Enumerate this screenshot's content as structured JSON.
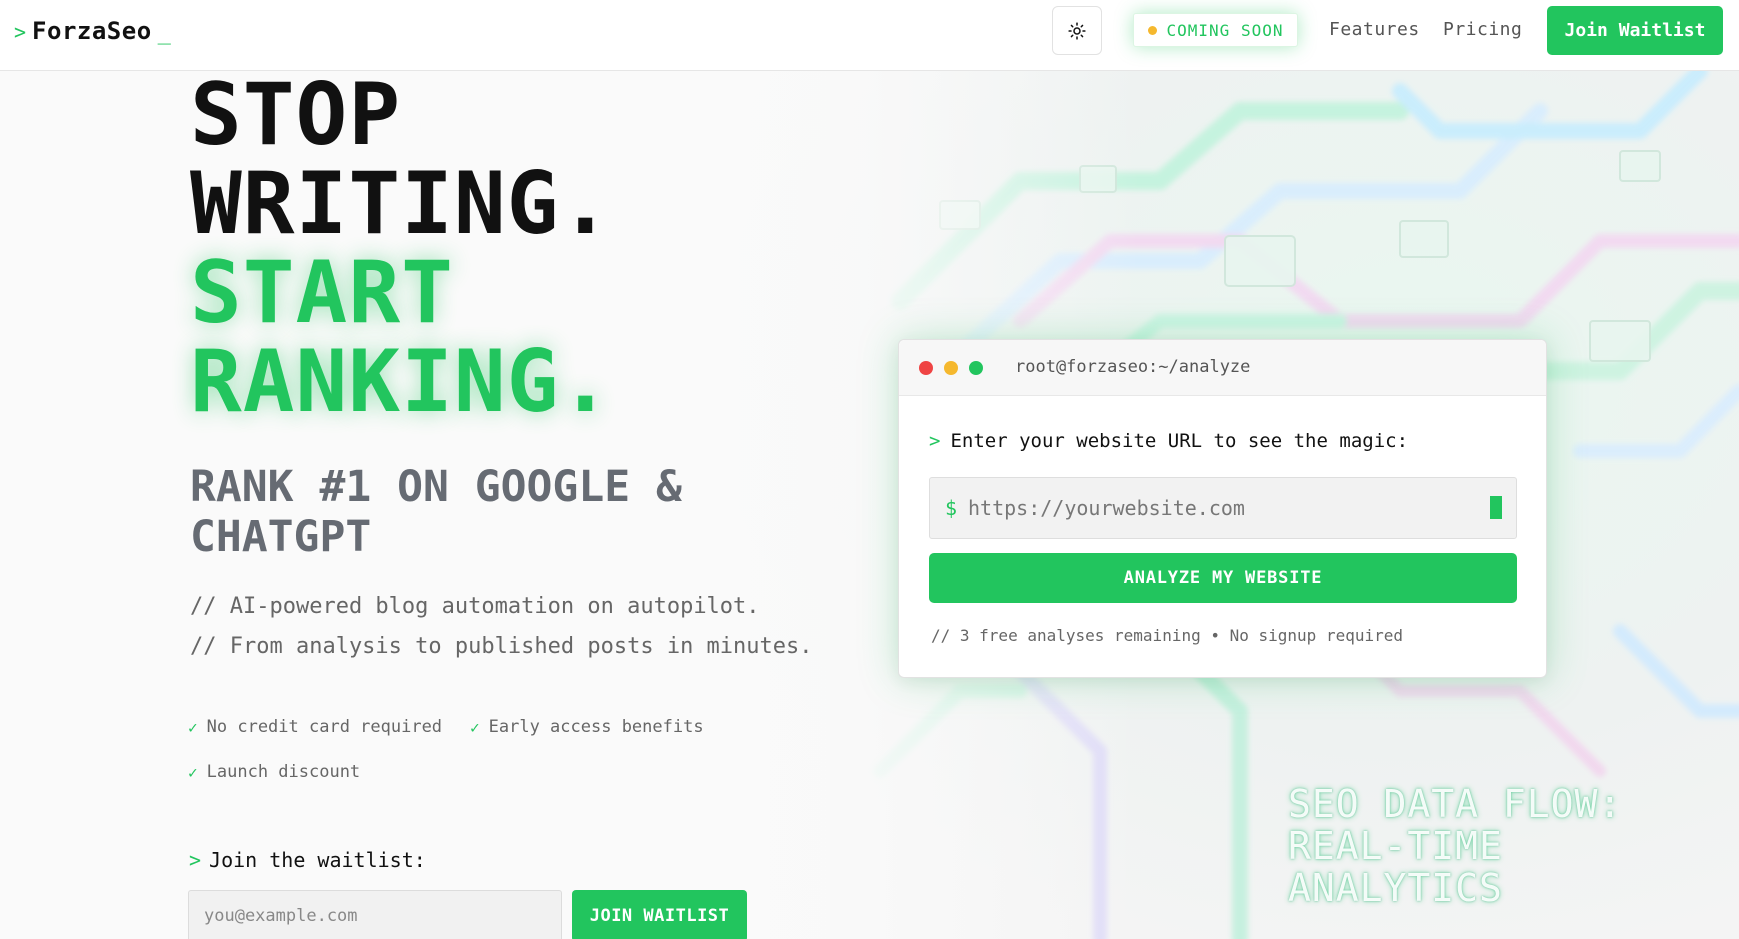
{
  "header": {
    "logo_caret": ">",
    "logo_text": "ForzaSeo",
    "logo_cursor": "_",
    "theme_icon": "sun-icon",
    "status_badge": "COMING SOON",
    "status_dot_color": "#f5b82e",
    "nav": {
      "features": "Features",
      "pricing": "Pricing"
    },
    "cta": "Join Waitlist"
  },
  "hero": {
    "headline_line1": "STOP",
    "headline_line2": "WRITING.",
    "headline_line3": "START",
    "headline_line4": "RANKING.",
    "subheadline": "RANK #1 ON GOOGLE & CHATGPT",
    "tagline_1": "// AI-powered blog automation on autopilot.",
    "tagline_2": "// From analysis to published posts in minutes.",
    "benefits": [
      "No credit card required",
      "Early access benefits",
      "Launch discount"
    ],
    "check_glyph": "✓",
    "waitlist_caret": ">",
    "waitlist_label": "Join the waitlist:",
    "email_placeholder": "you@example.com",
    "waitlist_button": "JOIN WAITLIST"
  },
  "terminal": {
    "path": "root@forzaseo:~/analyze",
    "prompt_caret": ">",
    "prompt": "Enter your website URL to see the magic:",
    "dollar": "$",
    "url_placeholder": "https://yourwebsite.com",
    "analyze_button": "ANALYZE MY WEBSITE",
    "note": "// 3 free analyses remaining • No signup required"
  },
  "background": {
    "caption_line1": "SEO DATA FLOW:",
    "caption_line2": "REAL-TIME ANALYTICS"
  },
  "colors": {
    "accent": "#22c55e",
    "text": "#111111",
    "muted": "#666666",
    "red_dot": "#ef4444",
    "yellow_dot": "#f5b82e"
  }
}
